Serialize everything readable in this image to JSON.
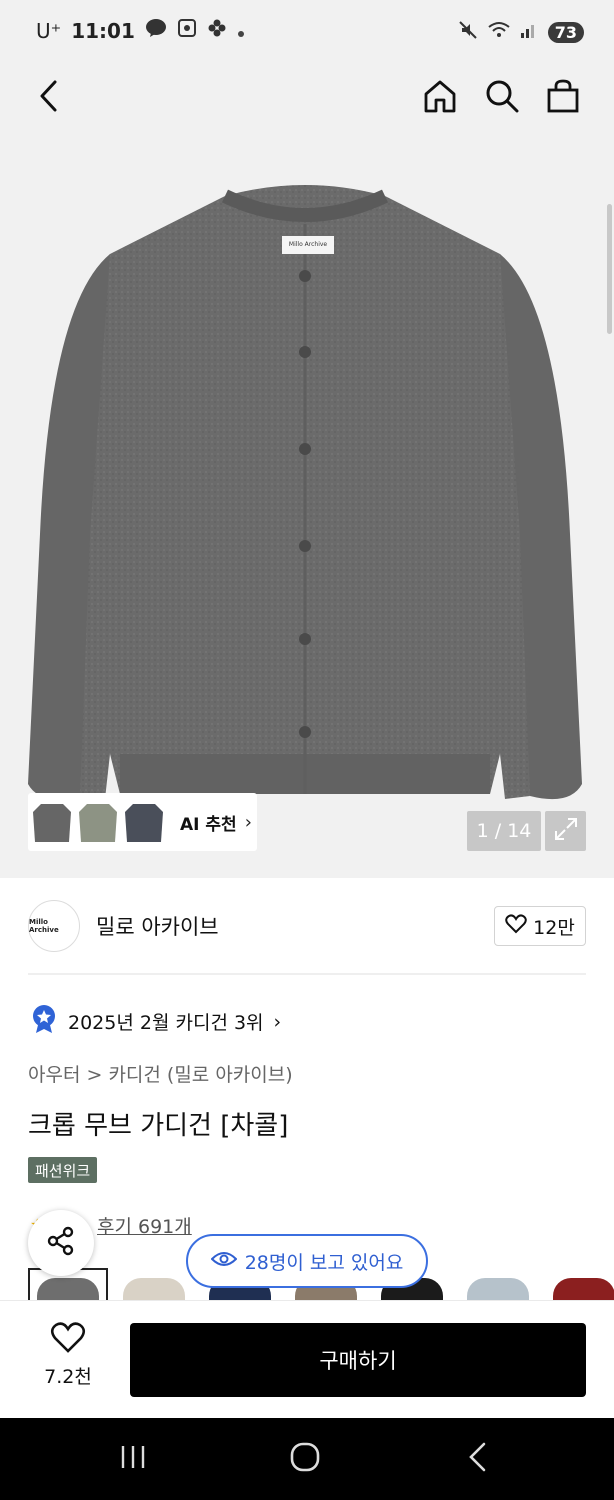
{
  "status": {
    "carrier": "U⁺",
    "time": "11:01",
    "notif_talk": "TALK",
    "battery": "73"
  },
  "nav": {
    "back_icon": "chevron-left-icon",
    "home_icon": "home-icon",
    "search_icon": "search-icon",
    "bag_icon": "shopping-bag-icon"
  },
  "gallery": {
    "current": "1",
    "total": "14",
    "counter_text": "1 / 14",
    "product_label_text": "Millo Archive",
    "ai_recommend_label": "AI 추천",
    "ai_arrow": "›"
  },
  "brand": {
    "logo_text": "Millo Archive",
    "name": "밀로 아카이브",
    "likes": "12만"
  },
  "ranking": {
    "text": "2025년 2월 카디건 3위",
    "arrow": "›"
  },
  "product": {
    "breadcrumb": "아우터 > 카디건 (밀로 아카이브)",
    "title": "크롭 무브 가디건 [차콜]",
    "tag": "패션위크",
    "reviews": "후기 691개"
  },
  "viewers": {
    "text": "28명이 보고 있어요"
  },
  "swatches": {
    "colors": [
      "#6e6e6e",
      "#d9d2c6",
      "#1f2f52",
      "#8b7b6a",
      "#1b1b1b",
      "#bfbfbf",
      "#b6c2cb",
      "#8b1f1f"
    ]
  },
  "bottom": {
    "wish_count": "7.2천",
    "buy_label": "구매하기"
  },
  "theme": {
    "accent_blue": "#3b6fe0",
    "tag_green": "#5d6f62",
    "buy_black": "#000000"
  }
}
